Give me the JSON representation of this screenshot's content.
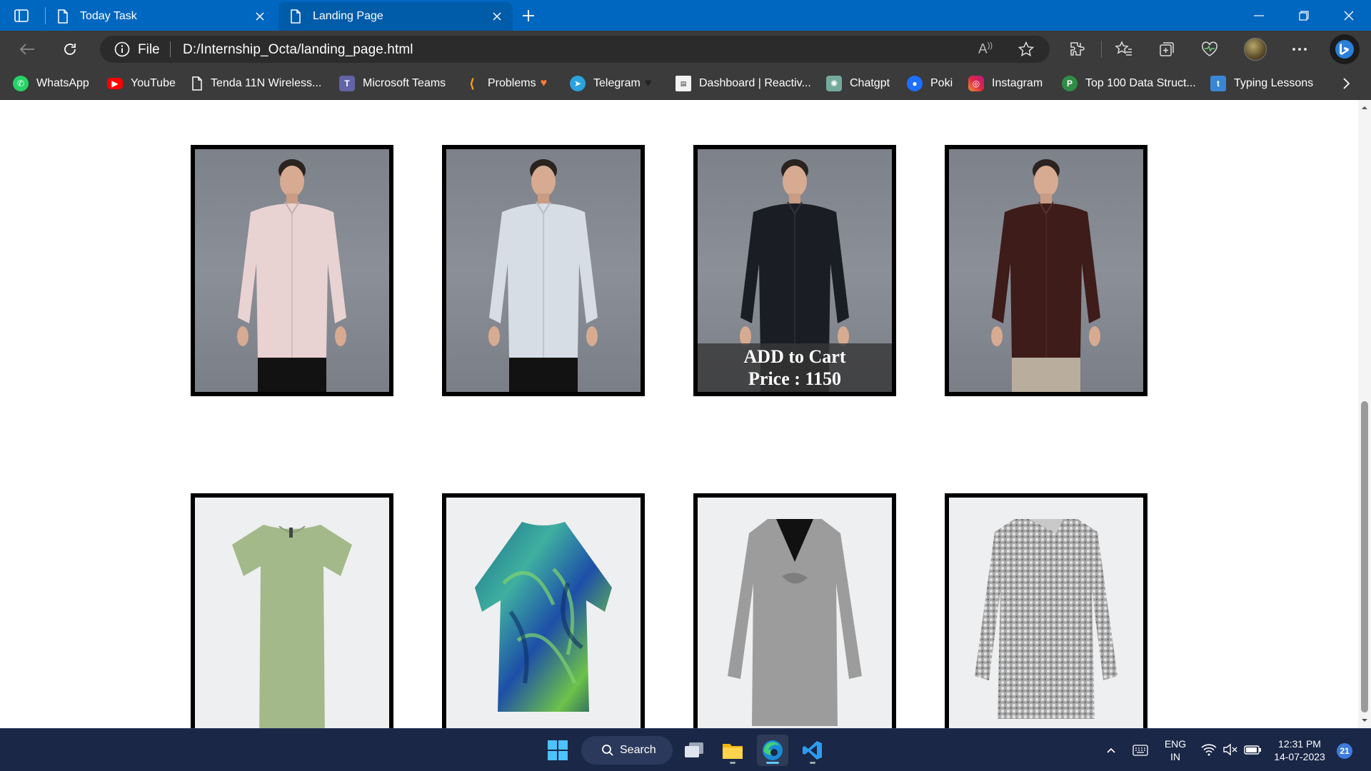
{
  "browser": {
    "tabs": [
      {
        "label": "Today Task",
        "active": false
      },
      {
        "label": "Landing Page",
        "active": true
      }
    ],
    "address": {
      "scheme": "File",
      "url": "D:/Internship_Octa/landing_page.html"
    },
    "bookmarks": [
      {
        "label": "WhatsApp",
        "icon": "whatsapp-icon",
        "color": "#25d366"
      },
      {
        "label": "YouTube",
        "icon": "youtube-icon",
        "color": "#ff0000"
      },
      {
        "label": "Tenda 11N Wireless...",
        "icon": "page-icon",
        "color": "#ffffff"
      },
      {
        "label": "Microsoft Teams",
        "icon": "teams-icon",
        "color": "#6264a7"
      },
      {
        "label": "Problems",
        "icon": "leetcode-icon",
        "color": "#f89f1b"
      },
      {
        "label": "Telegram",
        "icon": "telegram-icon",
        "color": "#2aa3df"
      },
      {
        "label": "Dashboard | Reactiv...",
        "icon": "dashboard-icon",
        "color": "#ffffff"
      },
      {
        "label": "Chatgpt",
        "icon": "chatgpt-icon",
        "color": "#74aa9c"
      },
      {
        "label": "Poki",
        "icon": "poki-icon",
        "color": "#1e6fff"
      },
      {
        "label": "Instagram",
        "icon": "instagram-icon",
        "color": "#d6249f"
      },
      {
        "label": "Top 100 Data Struct...",
        "icon": "gfg-icon",
        "color": "#2f8d46"
      },
      {
        "label": "Typing Lessons",
        "icon": "typing-icon",
        "color": "#3a86d4"
      }
    ]
  },
  "products": {
    "row1": [
      {
        "name": "shirt-pink",
        "color": "#e9d2d2"
      },
      {
        "name": "shirt-light-blue",
        "color": "#d6dde4"
      },
      {
        "name": "shirt-black",
        "color": "#1a1d24",
        "hovered": true
      },
      {
        "name": "shirt-maroon",
        "color": "#3d1c1a"
      }
    ],
    "row2": [
      {
        "name": "dress-green",
        "color": "#a3b98a"
      },
      {
        "name": "dress-tropical",
        "color": "#1f8f8a"
      },
      {
        "name": "dress-grey-twist",
        "color": "#9c9c9c"
      },
      {
        "name": "dress-silver-sequin",
        "color": "#b5b5b5"
      }
    ],
    "overlay": {
      "cart_label": "ADD to Cart",
      "price_label": "Price : 1150"
    }
  },
  "taskbar": {
    "search_label": "Search",
    "language_line1": "ENG",
    "language_line2": "IN",
    "time": "12:31 PM",
    "date": "14-07-2023",
    "notification_count": "21"
  }
}
